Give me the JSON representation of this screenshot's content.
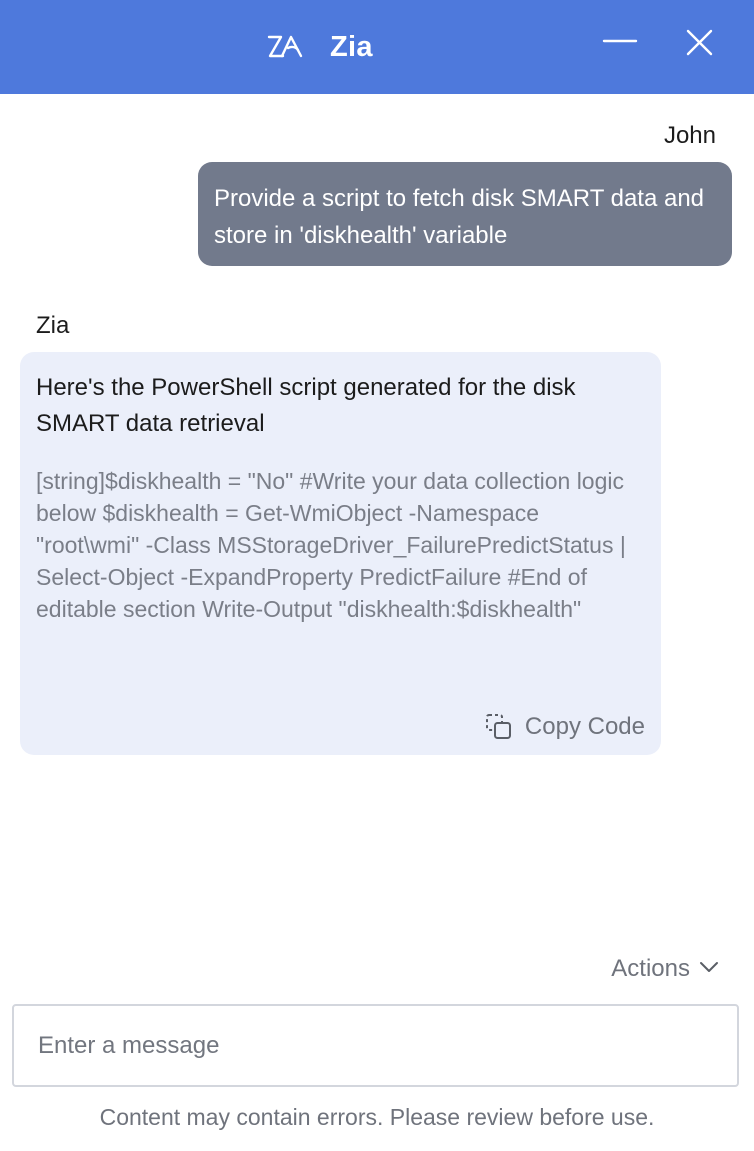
{
  "header": {
    "title": "Zia",
    "logo_icon": "zia-logo-icon",
    "minimize_icon": "minimize-icon",
    "close_icon": "close-icon",
    "background_color": "#4e79dc"
  },
  "conversation": {
    "messages": [
      {
        "sender": "John",
        "text": "Provide a script to fetch disk SMART data and store in 'diskhealth' variable"
      },
      {
        "sender": "Zia",
        "intro": "Here's the PowerShell script generated for the disk SMART data retrieval",
        "code": "[string]$diskhealth = \"No\" #Write your data collection logic below $diskhealth = Get-WmiObject -Namespace \"root\\wmi\" -Class MSStorageDriver_FailurePredictStatus | Select-Object -ExpandProperty PredictFailure #End of editable section Write-Output \"diskhealth:$diskhealth\"",
        "copy_label": "Copy Code",
        "copy_icon": "copy-icon"
      }
    ]
  },
  "actions": {
    "label": "Actions",
    "icon": "chevron-down-icon"
  },
  "composer": {
    "placeholder": "Enter a message",
    "value": ""
  },
  "footer": {
    "disclaimer": "Content may contain errors. Please review before use."
  },
  "colors": {
    "user_bubble": "#727a8c",
    "bot_bubble": "#ebeffa",
    "muted_text": "#6f737c"
  }
}
